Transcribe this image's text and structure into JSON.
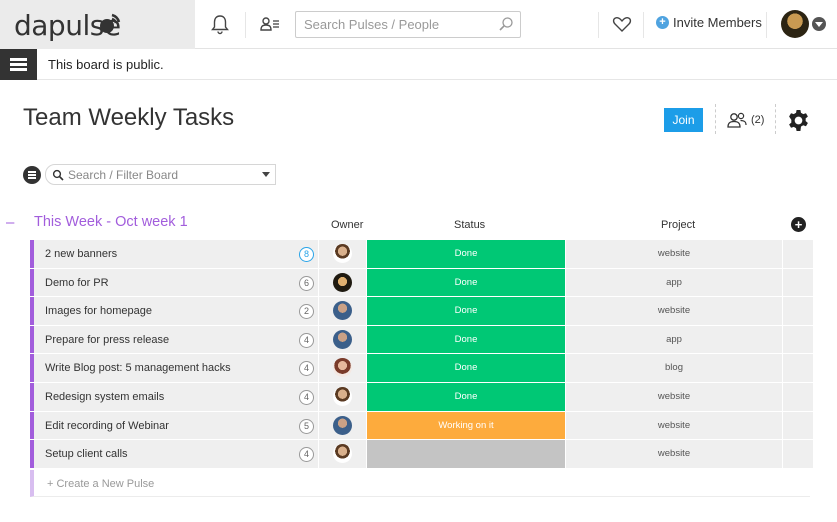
{
  "header": {
    "logo_text": "dapulse",
    "search_placeholder": "Search Pulses / People",
    "invite_label": "Invite Members"
  },
  "infobar": {
    "message": "This board is public."
  },
  "board": {
    "title": "Team Weekly Tasks",
    "join_label": "Join",
    "members_count": "(2)",
    "filter_placeholder": "Search / Filter Board"
  },
  "group": {
    "collapse_symbol": "–",
    "title": "This Week - Oct week 1",
    "color": "#a25ddc",
    "columns": {
      "owner": "Owner",
      "status": "Status",
      "project": "Project"
    },
    "new_pulse_label": "+ Create a New Pulse"
  },
  "rows": [
    {
      "name": "2 new banners",
      "count": "8",
      "status": "Done",
      "status_color": "#00c875",
      "project": "website",
      "avatar": "bearded-man"
    },
    {
      "name": "Demo for PR",
      "count": "6",
      "status": "Done",
      "status_color": "#00c875",
      "project": "app",
      "avatar": "dark-hair-man"
    },
    {
      "name": "Images for homepage",
      "count": "2",
      "status": "Done",
      "status_color": "#00c875",
      "project": "website",
      "avatar": "man-blue-shirt"
    },
    {
      "name": "Prepare for press release",
      "count": "4",
      "status": "Done",
      "status_color": "#00c875",
      "project": "app",
      "avatar": "man-blue-shirt"
    },
    {
      "name": "Write Blog post: 5 management hacks",
      "count": "4",
      "status": "Done",
      "status_color": "#00c875",
      "project": "blog",
      "avatar": "woman"
    },
    {
      "name": "Redesign system emails",
      "count": "4",
      "status": "Done",
      "status_color": "#00c875",
      "project": "website",
      "avatar": "bearded-man"
    },
    {
      "name": "Edit recording of Webinar",
      "count": "5",
      "status": "Working on it",
      "status_color": "#fdab3d",
      "project": "website",
      "avatar": "man-blue-shirt"
    },
    {
      "name": "Setup client calls",
      "count": "4",
      "status": "",
      "status_color": "#c4c4c4",
      "project": "website",
      "avatar": "bearded-man"
    }
  ]
}
